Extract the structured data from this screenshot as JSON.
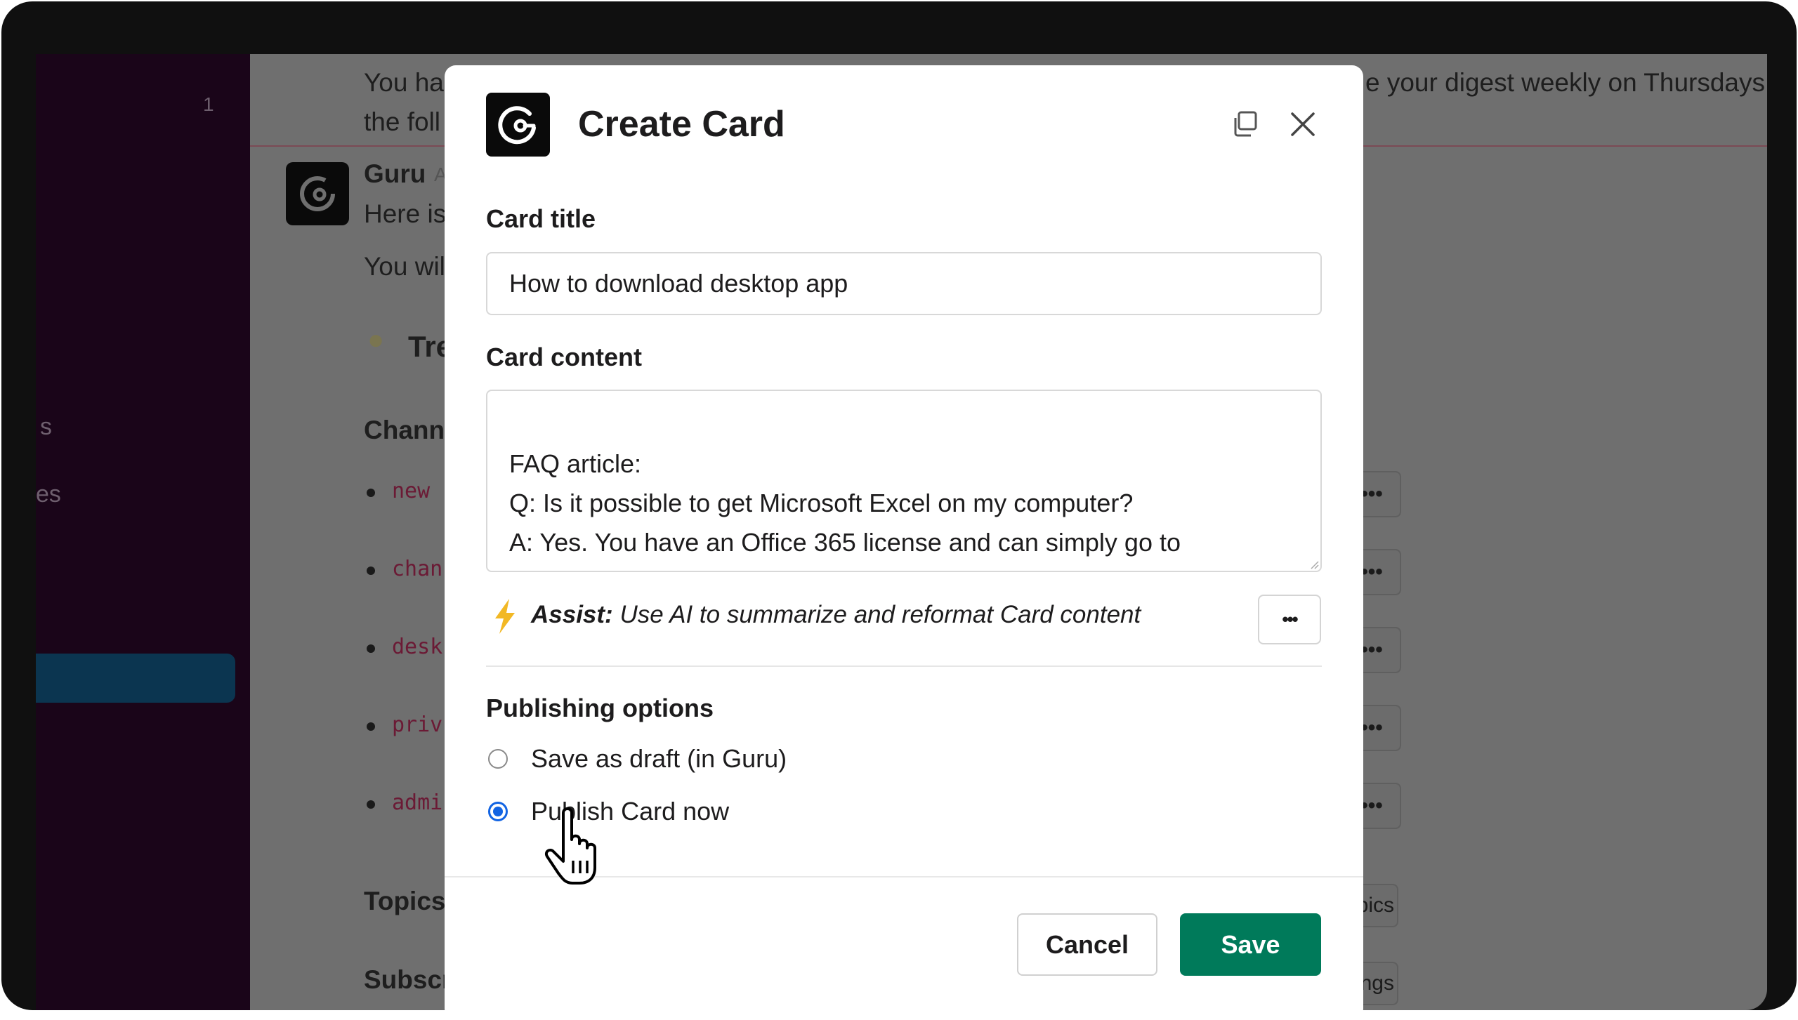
{
  "background": {
    "sidebar": {
      "badge": "1",
      "partial_item_1": "s",
      "partial_item_2": "es"
    },
    "main": {
      "intro_line_1": "You ha",
      "intro_line_1_end": "e your digest weekly on Thursdays",
      "intro_line_2": "the foll",
      "bot_name": "Guru",
      "bot_tag": "A",
      "message_1": "Here is",
      "message_2": "You wil",
      "trending_heading": "Tre",
      "channels_heading": "Channe",
      "channels": [
        "new",
        "chan",
        "desk",
        "priv",
        "admi"
      ],
      "topics_heading": "Topics",
      "subscriptions_heading": "Subscri",
      "more_label": "•••",
      "topics_button": "pics",
      "settings_button": "ings"
    }
  },
  "modal": {
    "title": "Create Card",
    "card_title_label": "Card title",
    "card_title_value": "How to download desktop app",
    "card_content_label": "Card content",
    "card_content_lines": [
      "",
      "FAQ article:",
      "Q: Is it possible to get Microsoft Excel on my computer?",
      "A: Yes. You have an Office 365 license and can simply go to"
    ],
    "assist_bold": "Assist:",
    "assist_text": "Use AI to summarize and reformat Card content",
    "more_label": "•••",
    "publishing_label": "Publishing options",
    "options": [
      {
        "label": "Save as draft (in Guru)",
        "selected": false
      },
      {
        "label": "Publish Card now",
        "selected": true
      }
    ],
    "cancel_label": "Cancel",
    "save_label": "Save"
  },
  "colors": {
    "save": "#007a5a",
    "radio_selected": "#1264e3",
    "assist_icon": "#f2b824",
    "sidebar": "#1a0519"
  }
}
